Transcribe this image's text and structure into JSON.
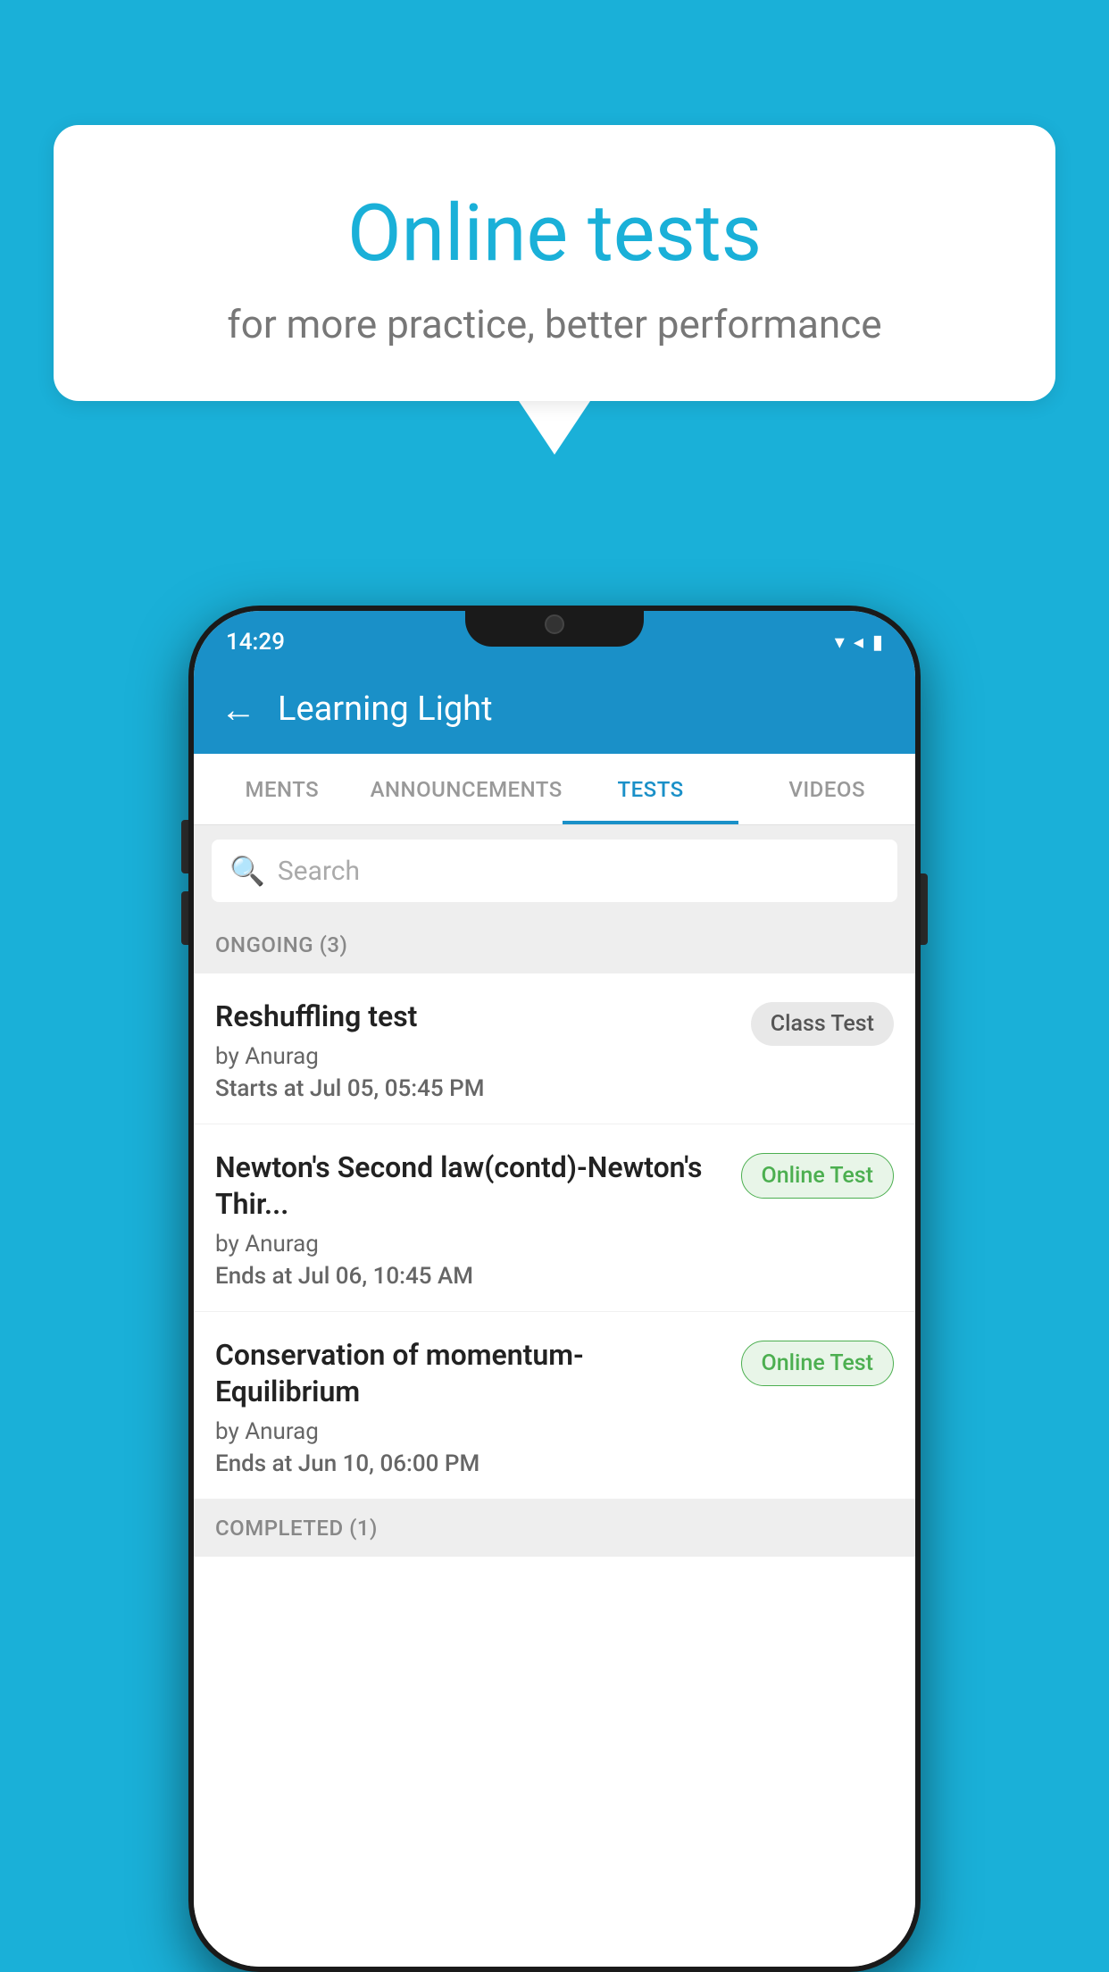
{
  "background_color": "#1ab0d8",
  "speech_bubble": {
    "title": "Online tests",
    "subtitle": "for more practice, better performance"
  },
  "phone": {
    "status_bar": {
      "time": "14:29",
      "wifi_icon": "▼",
      "signal_icon": "◀",
      "battery_icon": "▮"
    },
    "app_bar": {
      "back_label": "←",
      "title": "Learning Light"
    },
    "tabs": [
      {
        "label": "MENTS",
        "active": false
      },
      {
        "label": "ANNOUNCEMENTS",
        "active": false
      },
      {
        "label": "TESTS",
        "active": true
      },
      {
        "label": "VIDEOS",
        "active": false
      }
    ],
    "search": {
      "placeholder": "Search"
    },
    "ongoing_section": {
      "header": "ONGOING (3)",
      "items": [
        {
          "title": "Reshuffling test",
          "author": "by Anurag",
          "time_label": "Starts at",
          "time_value": "Jul 05, 05:45 PM",
          "badge": "Class Test",
          "badge_type": "class"
        },
        {
          "title": "Newton's Second law(contd)-Newton's Thir...",
          "author": "by Anurag",
          "time_label": "Ends at",
          "time_value": "Jul 06, 10:45 AM",
          "badge": "Online Test",
          "badge_type": "online"
        },
        {
          "title": "Conservation of momentum-Equilibrium",
          "author": "by Anurag",
          "time_label": "Ends at",
          "time_value": "Jun 10, 06:00 PM",
          "badge": "Online Test",
          "badge_type": "online"
        }
      ]
    },
    "completed_section": {
      "header": "COMPLETED (1)"
    }
  }
}
